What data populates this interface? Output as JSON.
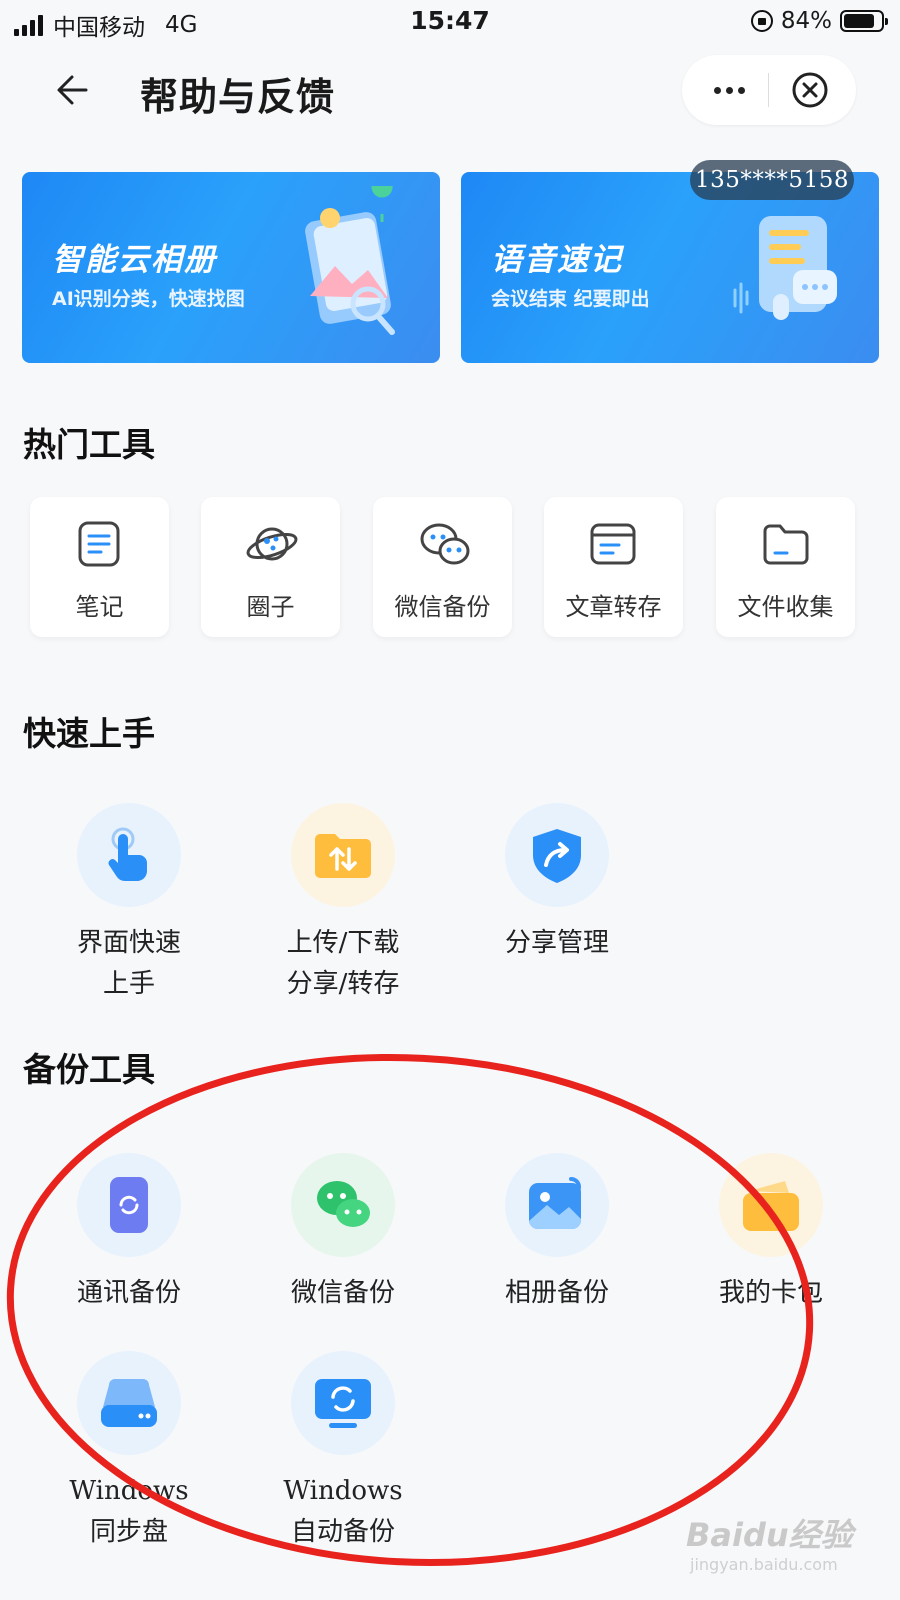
{
  "status_bar": {
    "carrier": "中国移动",
    "network": "4G",
    "time": "15:47",
    "battery": "84%",
    "battery_level": 0.84
  },
  "header": {
    "title": "帮助与反馈"
  },
  "banners": [
    {
      "title": "智能云相册",
      "subtitle": "AI识别分类，快速找图"
    },
    {
      "title": "语音速记",
      "subtitle": "会议结束 纪要即出"
    }
  ],
  "phone_badge": "135****5158",
  "sections": {
    "hot_tools": {
      "title": "热门工具",
      "items": [
        {
          "label": "笔记",
          "icon": "note-icon"
        },
        {
          "label": "圈子",
          "icon": "planet-icon"
        },
        {
          "label": "微信备份",
          "icon": "wechat-icon"
        },
        {
          "label": "文章转存",
          "icon": "article-icon"
        },
        {
          "label": "文件收集",
          "icon": "folder-icon"
        }
      ]
    },
    "quick_start": {
      "title": "快速上手",
      "items": [
        {
          "line1": "界面快速",
          "line2": "上手",
          "icon": "hand-tap-icon"
        },
        {
          "line1": "上传/下载",
          "line2": "分享/转存",
          "icon": "upload-download-icon"
        },
        {
          "line1": "分享管理",
          "line2": "",
          "icon": "share-shield-icon"
        }
      ]
    },
    "backup_tools": {
      "title": "备份工具",
      "items": [
        {
          "line1": "通讯备份",
          "line2": "",
          "icon": "contacts-sync-icon"
        },
        {
          "line1": "微信备份",
          "line2": "",
          "icon": "wechat-icon"
        },
        {
          "line1": "相册备份",
          "line2": "",
          "icon": "photo-sync-icon"
        },
        {
          "line1": "我的卡包",
          "line2": "",
          "icon": "wallet-icon"
        },
        {
          "line1": "Windows",
          "line2": "同步盘",
          "icon": "disk-icon"
        },
        {
          "line1": "Windows",
          "line2": "自动备份",
          "icon": "monitor-sync-icon"
        }
      ]
    }
  },
  "watermark": {
    "brand": "Baidu经验",
    "url": "jingyan.baidu.com"
  },
  "colors": {
    "accent": "#2a8ff7",
    "annotation": "#e8231d",
    "page_bg": "#f7f8fa"
  }
}
